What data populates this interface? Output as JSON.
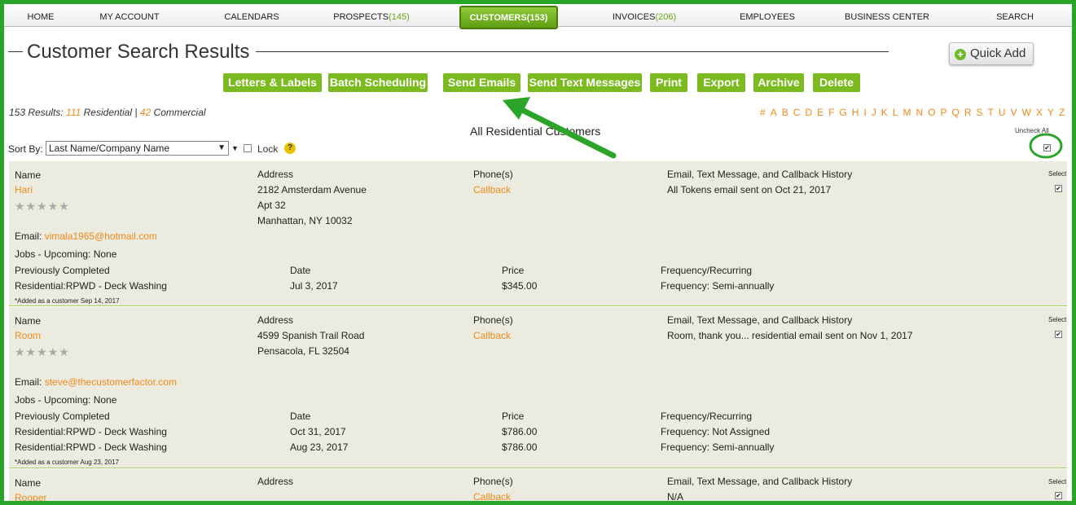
{
  "nav": {
    "items": [
      {
        "label": "HOME",
        "count": ""
      },
      {
        "label": "MY ACCOUNT",
        "count": ""
      },
      {
        "label": "CALENDARS",
        "count": ""
      },
      {
        "label": "PROSPECTS",
        "count": "(145)"
      },
      {
        "label": "CUSTOMERS",
        "count": "(153)"
      },
      {
        "label": "INVOICES",
        "count": "(206)"
      },
      {
        "label": "EMPLOYEES",
        "count": ""
      },
      {
        "label": "BUSINESS CENTER",
        "count": ""
      },
      {
        "label": "SEARCH",
        "count": ""
      }
    ]
  },
  "page": {
    "title": "Customer Search Results",
    "quick_add": "Quick Add",
    "quick_add_icon": "plus-circle-icon"
  },
  "actions": [
    "Letters & Labels",
    "Batch Scheduling",
    "Send Emails",
    "Send Text Messages",
    "Print",
    "Export",
    "Archive",
    "Delete"
  ],
  "results": {
    "prefix": "153 Results:",
    "residential_count": "111",
    "residential_label": "Residential",
    "sep": "|",
    "commercial_count": "42",
    "commercial_label": "Commercial"
  },
  "alphabet": [
    "#",
    "A",
    "B",
    "C",
    "D",
    "E",
    "F",
    "G",
    "H",
    "I",
    "J",
    "K",
    "L",
    "M",
    "N",
    "O",
    "P",
    "Q",
    "R",
    "S",
    "T",
    "U",
    "V",
    "W",
    "X",
    "Y",
    "Z"
  ],
  "section_title": "All Residential Customers",
  "uncheck_all": "Uncheck All",
  "sort": {
    "label": "Sort By:",
    "value": "Last Name/Company Name",
    "lock_label": "Lock",
    "help": "?"
  },
  "labels": {
    "name": "Name",
    "address": "Address",
    "phones": "Phone(s)",
    "history": "Email, Text Message, and Callback History",
    "select": "Select",
    "email": "Email:",
    "jobs": "Jobs - Upcoming:",
    "prev": "Previously Completed",
    "date": "Date",
    "price": "Price",
    "freq": "Frequency/Recurring",
    "callback": "Callback",
    "stars": "★★★★★"
  },
  "customers": [
    {
      "name": "Hari",
      "address": [
        "2182 Amsterdam Avenue",
        "Apt 32",
        "Manhattan, NY 10032"
      ],
      "history": "All Tokens email sent on Oct 21, 2017",
      "email": "vimala1965@hotmail.com",
      "jobs_upcoming": "None",
      "jobs": [
        {
          "service": "Residential:RPWD - Deck Washing",
          "date": "Jul 3, 2017",
          "price": "$345.00",
          "frequency": "Frequency: Semi-annually"
        }
      ],
      "added": "*Added as a customer Sep 14, 2017"
    },
    {
      "name": "Room",
      "address": [
        "4599 Spanish Trail Road",
        "Pensacola, FL 32504"
      ],
      "history": "Room, thank you... residential email sent on Nov 1, 2017",
      "email": "steve@thecustomerfactor.com",
      "jobs_upcoming": "None",
      "jobs": [
        {
          "service": "Residential:RPWD - Deck Washing",
          "date": "Oct 31, 2017",
          "price": "$786.00",
          "frequency": "Frequency: Not Assigned"
        },
        {
          "service": "Residential:RPWD - Deck Washing",
          "date": "Aug 23, 2017",
          "price": "$786.00",
          "frequency": "Frequency: Semi-annually"
        }
      ],
      "added": "*Added as a customer Aug 23, 2017"
    },
    {
      "name": "Rooper",
      "address": [],
      "history": "N/A"
    }
  ],
  "colors": {
    "accent_green": "#7cbb1f",
    "link_orange": "#f08a1c",
    "frame_green": "#28a428",
    "card_bg": "#ebebdf"
  }
}
